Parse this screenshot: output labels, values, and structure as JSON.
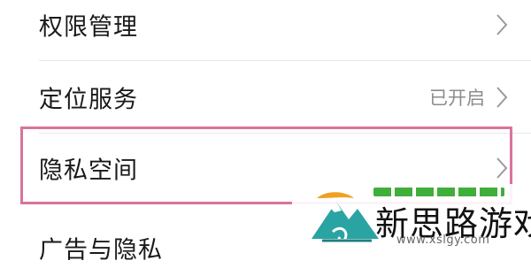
{
  "settings": {
    "items": [
      {
        "label": "权限管理",
        "value": ""
      },
      {
        "label": "定位服务",
        "value": "已开启"
      },
      {
        "label": "隐私空间",
        "value": ""
      },
      {
        "label": "广告与隐私",
        "value": ""
      }
    ]
  },
  "highlight": {
    "color": "#d9739c"
  },
  "watermark": {
    "title": "新思路游戏",
    "url": "www.xslgy.com",
    "icon": "mountain-logo-icon",
    "colors": {
      "green": "#3fae3a",
      "teal": "#2aa3a3"
    }
  },
  "icons": {
    "chevron": "chevron-right-icon"
  }
}
